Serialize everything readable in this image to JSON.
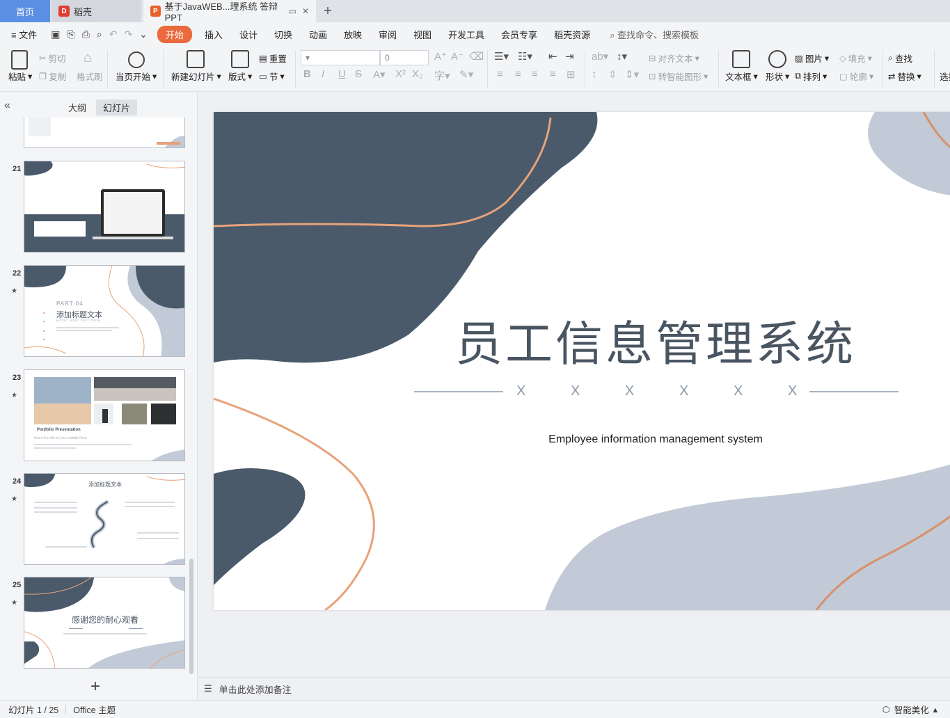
{
  "tabs": {
    "home": "首页",
    "doc1": "稻壳",
    "active": "基于JavaWEB...理系统 答辩PPT",
    "new_tab": "+"
  },
  "menu": {
    "file": "文件",
    "items": [
      "开始",
      "插入",
      "设计",
      "切换",
      "动画",
      "放映",
      "审阅",
      "视图",
      "开发工具",
      "会员专享",
      "稻壳资源"
    ],
    "search": "查找命令、搜索模板"
  },
  "ribbon": {
    "paste": "粘贴",
    "cut": "剪切",
    "copy": "复制",
    "format_painter": "格式刷",
    "play_from_current": "当页开始",
    "new_slide": "新建幻灯片",
    "layout": "版式",
    "reset": "重置",
    "section": "节",
    "font_size": "0",
    "align_text": "对齐文本",
    "smart_graphic": "转智能图形",
    "textbox": "文本框",
    "shape": "形状",
    "picture": "图片",
    "arrange": "排列",
    "fill": "填充",
    "outline": "轮廓",
    "find": "查找",
    "replace": "替换",
    "select": "选择"
  },
  "left_panel": {
    "tab_outline": "大纲",
    "tab_slides": "幻灯片",
    "thumbnails": [
      {
        "num": "21",
        "starred": false
      },
      {
        "num": "22",
        "starred": true,
        "part": "PART 04",
        "title": "添加标题文本",
        "sub": "Enter your text here"
      },
      {
        "num": "23",
        "starred": true,
        "title": "Portfolio Presentation",
        "sub": "Insert the title of your subtitle Here"
      },
      {
        "num": "24",
        "starred": true,
        "title": "添加标题文本"
      },
      {
        "num": "25",
        "starred": true,
        "title": "感谢您的耐心观看"
      }
    ],
    "star": "★",
    "add": "+"
  },
  "slide": {
    "title": "员工信息管理系统",
    "decor": [
      "X",
      "X",
      "X",
      "X",
      "X",
      "X"
    ],
    "subtitle": "Employee information management system"
  },
  "notes": {
    "placeholder": "单击此处添加备注"
  },
  "status": {
    "slide_counter": "幻灯片 1 / 25",
    "theme": "Office 主题",
    "beautify": "智能美化"
  },
  "colors": {
    "accent": "#ea6a3d",
    "home_tab": "#5b8fe3",
    "slide_dark": "#4a5a6a",
    "slide_light": "#c1cad6",
    "slide_line": "#e8a27a"
  }
}
